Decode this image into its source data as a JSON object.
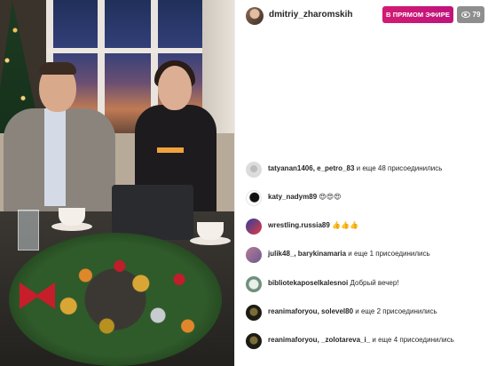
{
  "header": {
    "host_name": "dmitriy_zharomskih",
    "live_button_label": "В ПРЯМОМ ЭФИРЕ",
    "viewer_count": "79"
  },
  "comments": [
    {
      "user": "tatyanan1406, e_petro_83",
      "message": "и еще 48 присоединились"
    },
    {
      "user": "katy_nadym89",
      "message": "😍😍😍"
    },
    {
      "user": "wrestling.russia89",
      "message": "👍👍👍"
    },
    {
      "user": "julik48_, barykinamaria",
      "message": "и еще 1 присоединились"
    },
    {
      "user": "bibliotekaposelkalesnoi",
      "message": "Добрый вечер!"
    },
    {
      "user": "reanimaforyou, solevel80",
      "message": "и еще 2 присоединились"
    },
    {
      "user": "reanimaforyou, _zolotareva_i_",
      "message": "и еще 4 присоединились"
    }
  ],
  "colors": {
    "live_button": "#d21b73",
    "viewer_pill": "#8e8e8e",
    "text": "#262626"
  }
}
